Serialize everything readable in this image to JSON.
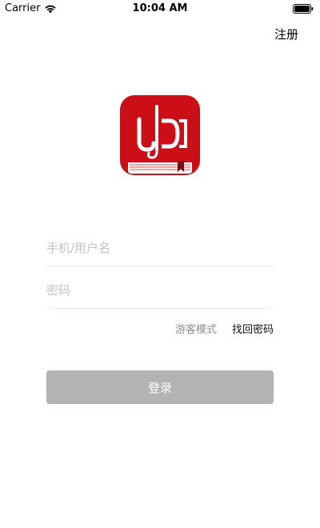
{
  "status_bar": {
    "carrier": "Carrier",
    "time": "10:04 AM",
    "wifi_icon": "wifi-icon",
    "battery_icon": "battery-icon"
  },
  "header": {
    "register_label": "注册"
  },
  "logo": {
    "icon": "book-logo-icon",
    "brand_color": "#cc0f16"
  },
  "form": {
    "username_placeholder": "手机/用户名",
    "username_value": "",
    "password_placeholder": "密码",
    "password_value": "",
    "guest_mode_label": "游客模式",
    "forgot_password_label": "找回密码",
    "login_label": "登录"
  },
  "colors": {
    "login_button_bg": "#b3b3b3",
    "placeholder": "#c4c4c4",
    "guest_text": "#8e8e8e"
  }
}
